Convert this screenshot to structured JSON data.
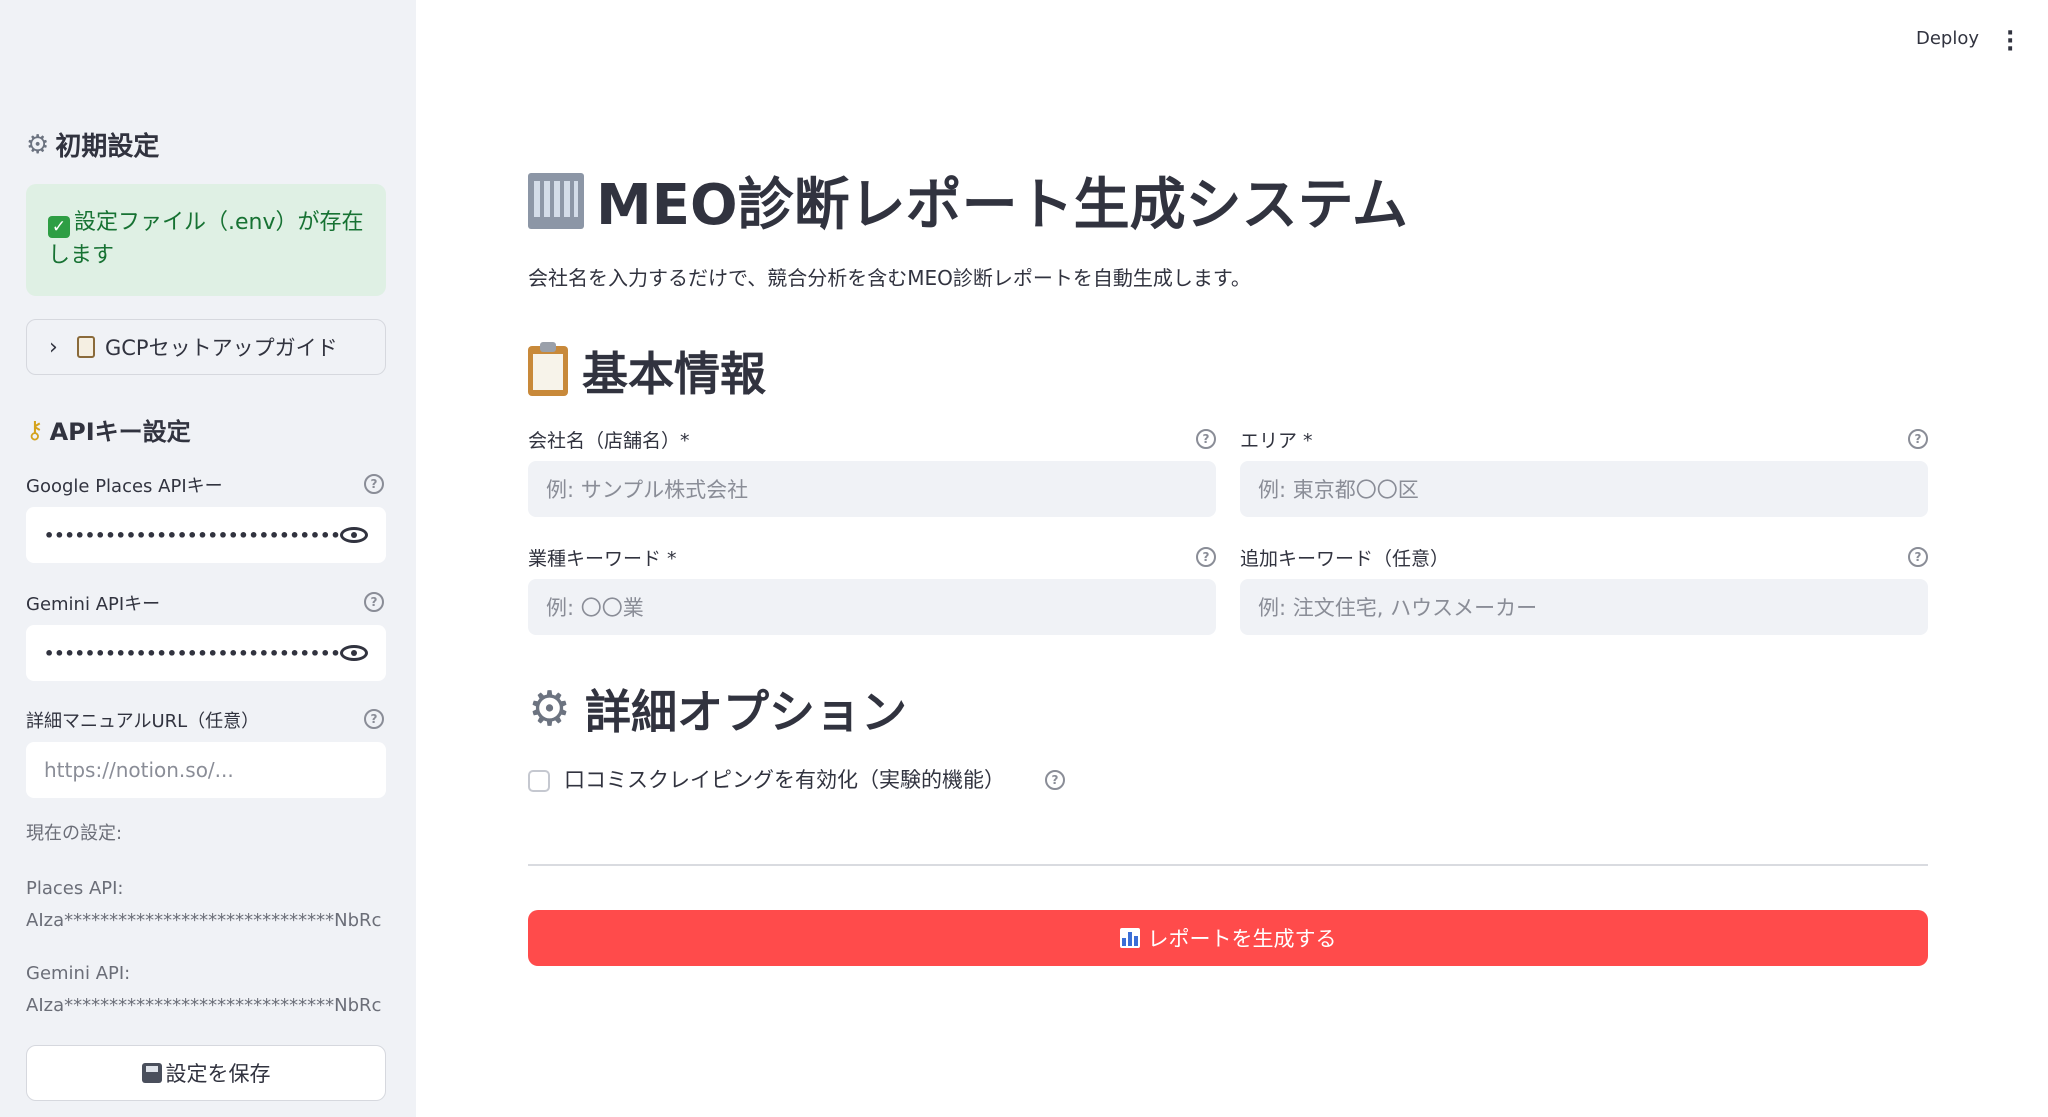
{
  "header": {
    "deploy_label": "Deploy",
    "menu_icon": "more-vertical-icon"
  },
  "sidebar": {
    "initial_settings_title": "初期設定",
    "env_status": "設定ファイル（.env）が存在します",
    "gcp_guide_label": "GCPセットアップガイド",
    "api_keys_title": "APIキー設定",
    "google_places_label": "Google Places APIキー",
    "google_places_value": "••••••••••••••••••••••••••••••••••••••••",
    "gemini_label": "Gemini APIキー",
    "gemini_value": "••••••••••••••••••••••••••••••••••••••••",
    "manual_url_label": "詳細マニュアルURL（任意）",
    "manual_url_placeholder": "https://notion.so/...",
    "current_settings_label": "現在の設定:",
    "places_api_label": "Places API:",
    "places_api_value": "AIza******************************NbRc",
    "gemini_api_label": "Gemini API:",
    "gemini_api_value": "AIza******************************NbRc",
    "save_label": "設定を保存"
  },
  "main": {
    "title": "MEO診断レポート生成システム",
    "subtitle": "会社名を入力するだけで、競合分析を含むMEO診断レポートを自動生成します。",
    "basic_info_title": "基本情報",
    "company_label": "会社名（店舗名）*",
    "company_placeholder": "例: サンプル株式会社",
    "area_label": "エリア *",
    "area_placeholder": "例: 東京都〇〇区",
    "industry_label": "業種キーワード *",
    "industry_placeholder": "例: 〇〇業",
    "extra_keyword_label": "追加キーワード（任意）",
    "extra_keyword_placeholder": "例: 注文住宅, ハウスメーカー",
    "options_title": "詳細オプション",
    "scraping_label": "口コミスクレイピングを有効化（実験的機能）",
    "generate_label": "レポートを生成する"
  },
  "colors": {
    "primary": "#ff4b4b",
    "success_bg": "#dff0e4",
    "success_text": "#177233",
    "sidebar_bg": "#f0f2f6"
  }
}
